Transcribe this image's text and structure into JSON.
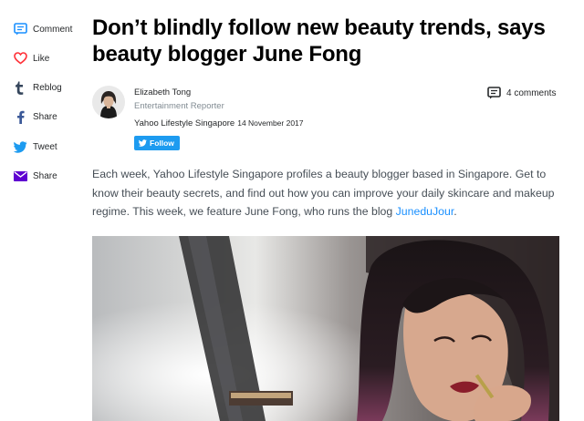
{
  "share": {
    "items": [
      {
        "label": "Comment",
        "icon": "comment-icon",
        "color": "#188fff"
      },
      {
        "label": "Like",
        "icon": "heart-icon",
        "color": "#ff333a"
      },
      {
        "label": "Reblog",
        "icon": "tumblr-icon",
        "color": "#35465c"
      },
      {
        "label": "Share",
        "icon": "facebook-icon",
        "color": "#3b5998"
      },
      {
        "label": "Tweet",
        "icon": "twitter-icon",
        "color": "#1d9bf0"
      },
      {
        "label": "Share",
        "icon": "email-icon",
        "color": "#5f01d1"
      }
    ]
  },
  "article": {
    "title": "Don’t blindly follow new beauty trends, says beauty blogger June Fong",
    "author_name": "Elizabeth Tong",
    "author_role": "Entertainment Reporter",
    "provider": "Yahoo Lifestyle Singapore",
    "date": "14 November 2017",
    "follow_label": "Follow",
    "comments_label": "4 comments",
    "body_before_link": "Each week, Yahoo Lifestyle Singapore profiles a beauty blogger based in Singapore. Get to know their beauty secrets, and find out how you can improve your daily skincare and makeup regime. This week, we feature June Fong, who runs the blog ",
    "body_link": "JuneduJour",
    "body_after_link": "."
  },
  "colors": {
    "link": "#188fff",
    "follow_bg": "#1d9bf0"
  }
}
